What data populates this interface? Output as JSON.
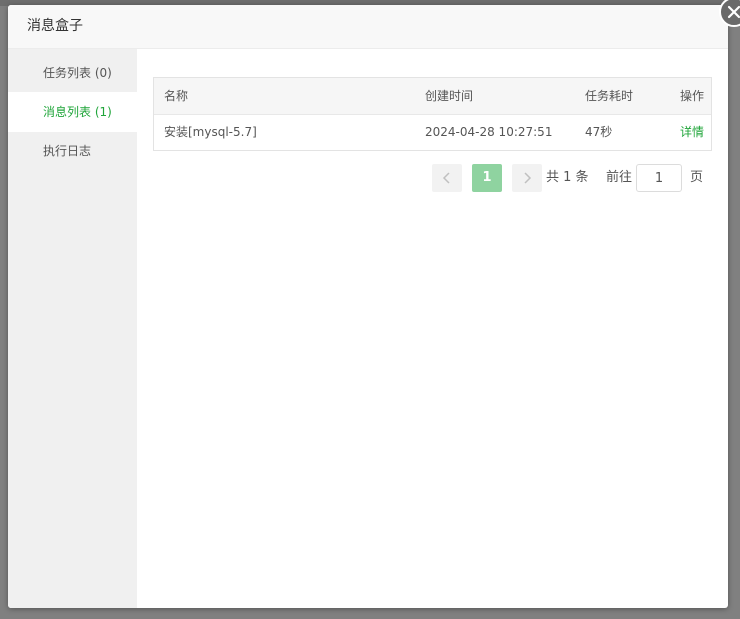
{
  "dialog": {
    "title": "消息盒子"
  },
  "sidebar": {
    "items": [
      {
        "label": "任务列表 (0)"
      },
      {
        "label": "消息列表 (1)"
      },
      {
        "label": "执行日志"
      }
    ],
    "active_index": 1
  },
  "table": {
    "columns": [
      "名称",
      "创建时间",
      "任务耗时",
      "操作"
    ],
    "rows": [
      {
        "name": "安装[mysql-5.7]",
        "created": "2024-04-28 10:27:51",
        "duration": "47秒",
        "action": "详情"
      }
    ]
  },
  "pagination": {
    "current_page": "1",
    "total_text": "共 1 条",
    "goto_label": "前往",
    "goto_value": "1",
    "page_suffix": "页"
  },
  "colors": {
    "accent": "#20a53a",
    "page_active": "#8fd3a0"
  }
}
